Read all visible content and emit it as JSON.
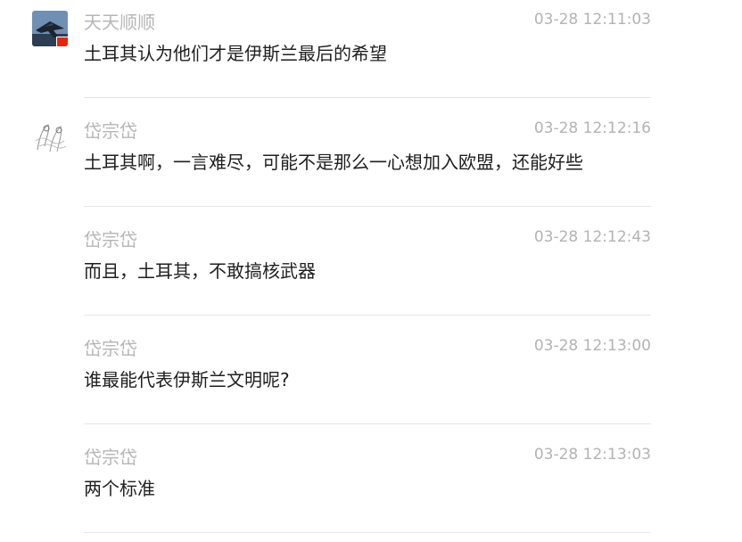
{
  "messages": [
    {
      "author": "天天顺顺",
      "time": "03-28 12:11:03",
      "text": "土耳其认为他们才是伊斯兰最后的希望",
      "avatar": "plane-avatar"
    },
    {
      "author": "岱宗岱",
      "time": "03-28 12:12:16",
      "text": "土耳其啊，一言难尽，可能不是那么一心想加入欧盟，还能好些",
      "avatar": "sketch-avatar"
    },
    {
      "author": "岱宗岱",
      "time": "03-28 12:12:43",
      "text": "而且，土耳其，不敢搞核武器"
    },
    {
      "author": "岱宗岱",
      "time": "03-28 12:13:00",
      "text": "谁最能代表伊斯兰文明呢?"
    },
    {
      "author": "岱宗岱",
      "time": "03-28 12:13:03",
      "text": "两个标准"
    }
  ]
}
